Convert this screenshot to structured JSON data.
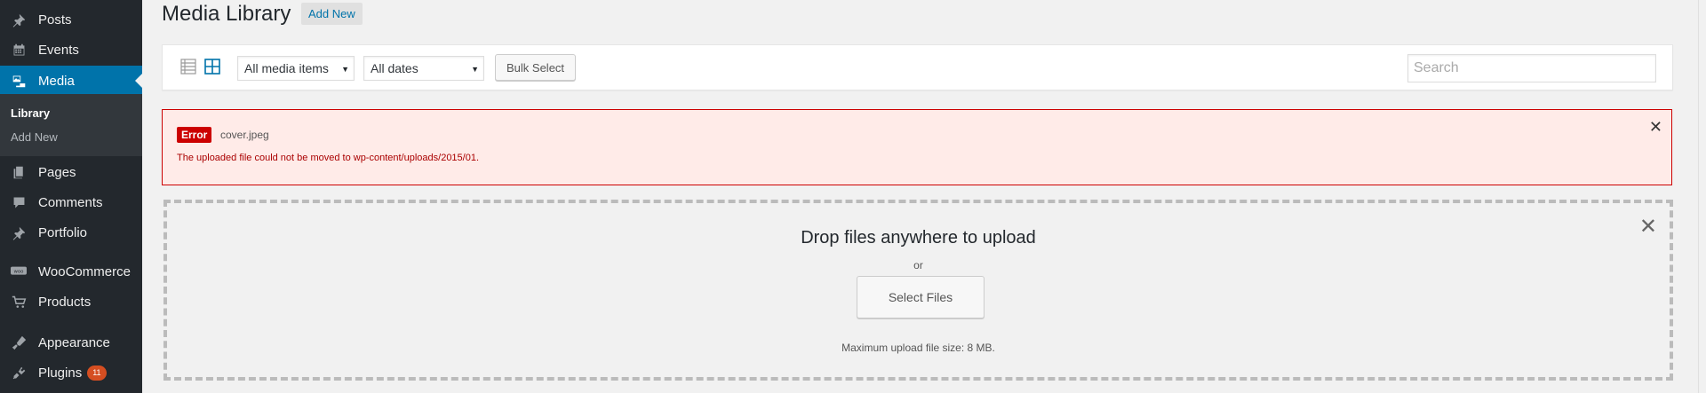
{
  "sidebar": {
    "items": [
      {
        "label": "Posts",
        "icon": "pushpin-icon"
      },
      {
        "label": "Events",
        "icon": "calendar-icon"
      },
      {
        "label": "Media",
        "icon": "media-icon",
        "current": true
      },
      {
        "label": "Pages",
        "icon": "pages-icon"
      },
      {
        "label": "Comments",
        "icon": "comment-icon"
      },
      {
        "label": "Portfolio",
        "icon": "pushpin-icon"
      },
      {
        "label": "WooCommerce",
        "icon": "woo-icon"
      },
      {
        "label": "Products",
        "icon": "cart-icon"
      },
      {
        "label": "Appearance",
        "icon": "brush-icon"
      },
      {
        "label": "Plugins",
        "icon": "plugin-icon",
        "badge": "11"
      }
    ],
    "submenu": [
      {
        "label": "Library",
        "active": true
      },
      {
        "label": "Add New"
      }
    ]
  },
  "header": {
    "title": "Media Library",
    "add_new": "Add New"
  },
  "toolbar": {
    "filter_type": "All media items",
    "filter_date": "All dates",
    "bulk_select": "Bulk Select",
    "search_placeholder": "Search"
  },
  "error": {
    "tag": "Error",
    "file": "cover.jpeg",
    "message": "The uploaded file could not be moved to wp-content/uploads/2015/01."
  },
  "uploader": {
    "title": "Drop files anywhere to upload",
    "or": "or",
    "button": "Select Files",
    "max_size": "Maximum upload file size: 8 MB."
  },
  "colors": {
    "sidebar_bg": "#23282d",
    "accent": "#0073aa",
    "error": "#cc0000",
    "badge": "#d54e21"
  }
}
